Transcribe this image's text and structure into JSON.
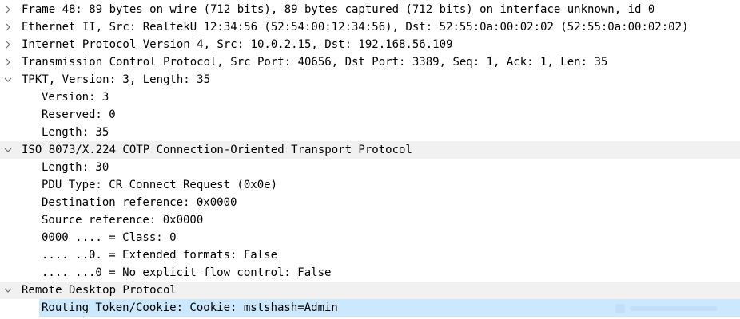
{
  "tree": {
    "frame": "Frame 48: 89 bytes on wire (712 bits), 89 bytes captured (712 bits) on interface unknown, id 0",
    "ethernet": "Ethernet II, Src: RealtekU_12:34:56 (52:54:00:12:34:56), Dst: 52:55:0a:00:02:02 (52:55:0a:00:02:02)",
    "ip": "Internet Protocol Version 4, Src: 10.0.2.15, Dst: 192.168.56.109",
    "tcp": "Transmission Control Protocol, Src Port: 40656, Dst Port: 3389, Seq: 1, Ack: 1, Len: 35",
    "tpkt": {
      "header": "TPKT, Version: 3, Length: 35",
      "fields": [
        "Version: 3",
        "Reserved: 0",
        "Length: 35"
      ]
    },
    "cotp": {
      "header": "ISO 8073/X.224 COTP Connection-Oriented Transport Protocol",
      "fields": [
        "Length: 30",
        "PDU Type: CR Connect Request (0x0e)",
        "Destination reference: 0x0000",
        "Source reference: 0x0000",
        "0000 .... = Class: 0",
        ".... ..0. = Extended formats: False",
        ".... ...0 = No explicit flow control: False"
      ]
    },
    "rdp": {
      "header": "Remote Desktop Protocol",
      "fields": [
        "Routing Token/Cookie: Cookie: mstshash=Admin"
      ]
    }
  },
  "icons": {
    "collapsed": "chevron-right-icon",
    "expanded": "chevron-down-icon"
  },
  "colors": {
    "section_bg": "#f1f1f1",
    "selected_bg": "#cce8ff",
    "chevron": "#6d6d6d"
  }
}
